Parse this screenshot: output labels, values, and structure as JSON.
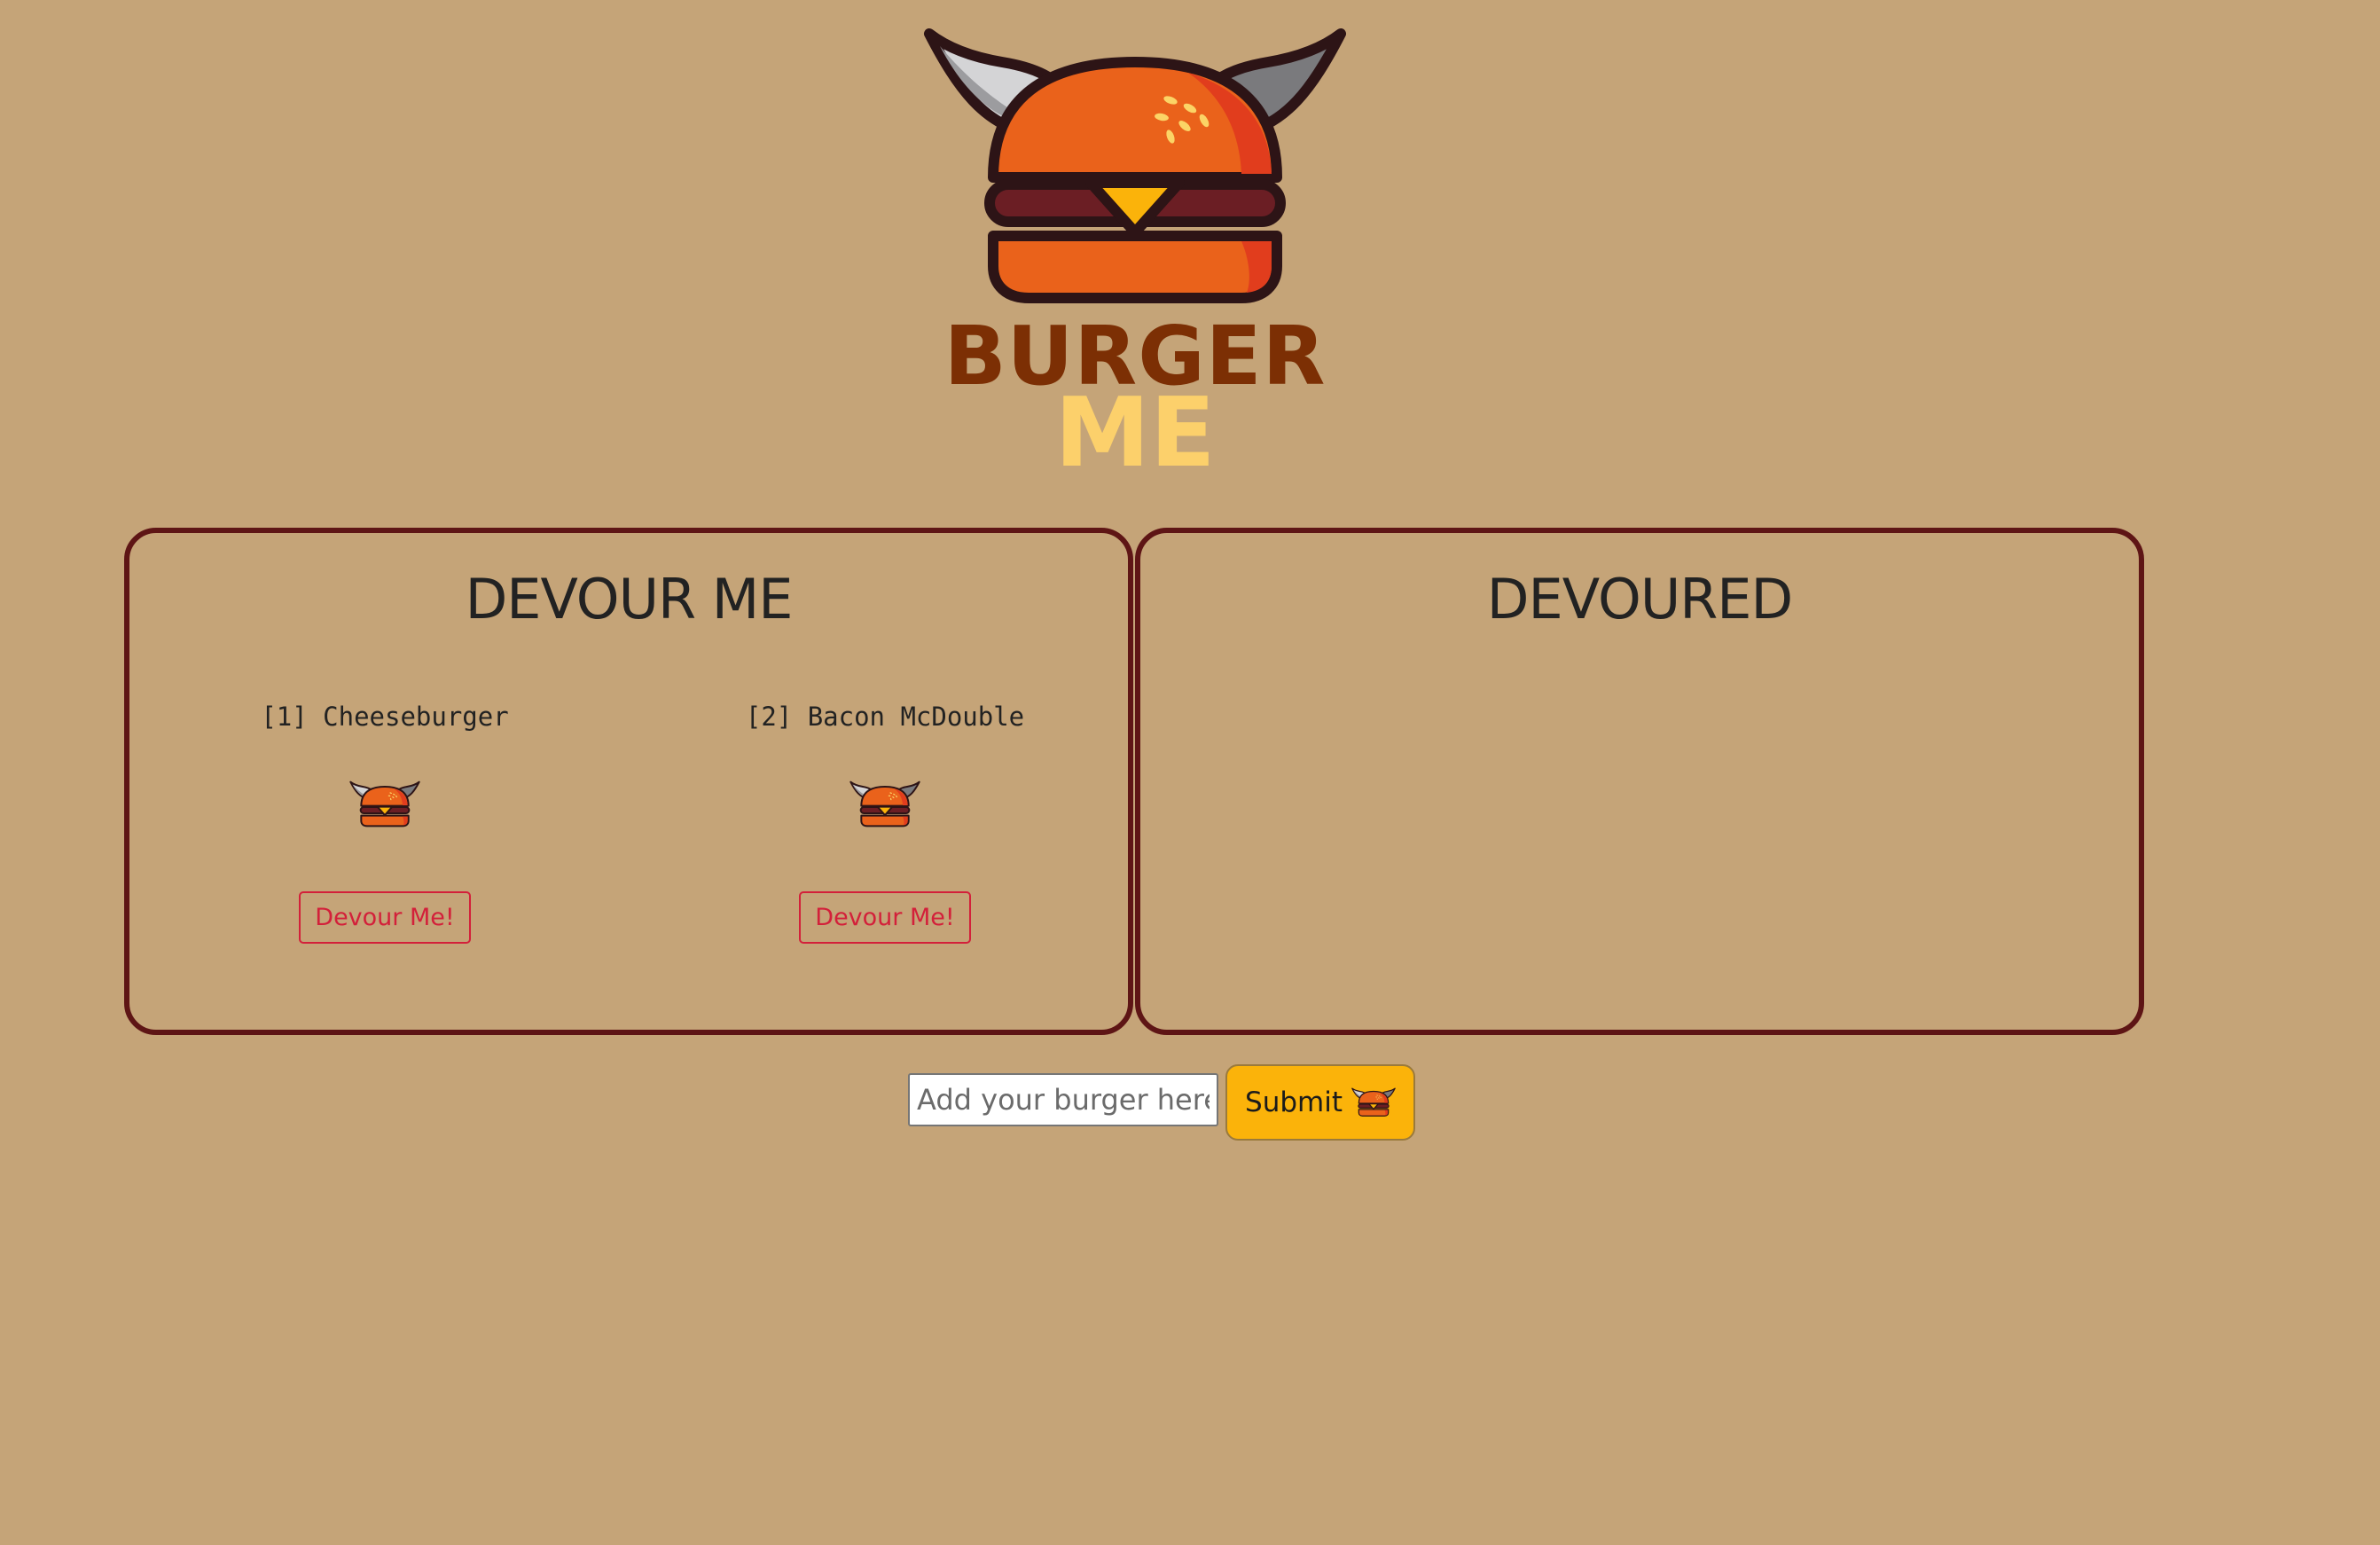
{
  "logo": {
    "line1": "BURGER",
    "line2": "ME",
    "icon": "horned-burger-icon"
  },
  "panels": {
    "devour": {
      "title": "DEVOUR ME",
      "burgers": [
        {
          "label": "[1] Cheeseburger",
          "button": "Devour Me!",
          "icon": "horned-burger-icon"
        },
        {
          "label": "[2] Bacon McDouble",
          "button": "Devour Me!",
          "icon": "horned-burger-icon"
        }
      ]
    },
    "devoured": {
      "title": "DEVOURED",
      "burgers": []
    }
  },
  "form": {
    "placeholder": "Add your burger here",
    "submit_label": "Submit",
    "submit_icon": "horned-burger-icon"
  },
  "colors": {
    "background": "#c5a478",
    "panel_border": "#5e1515",
    "button_red": "#d3203a",
    "submit_bg": "#fbb30a",
    "logo_brown": "#7c2f04",
    "logo_yellow": "#fcd06b"
  }
}
